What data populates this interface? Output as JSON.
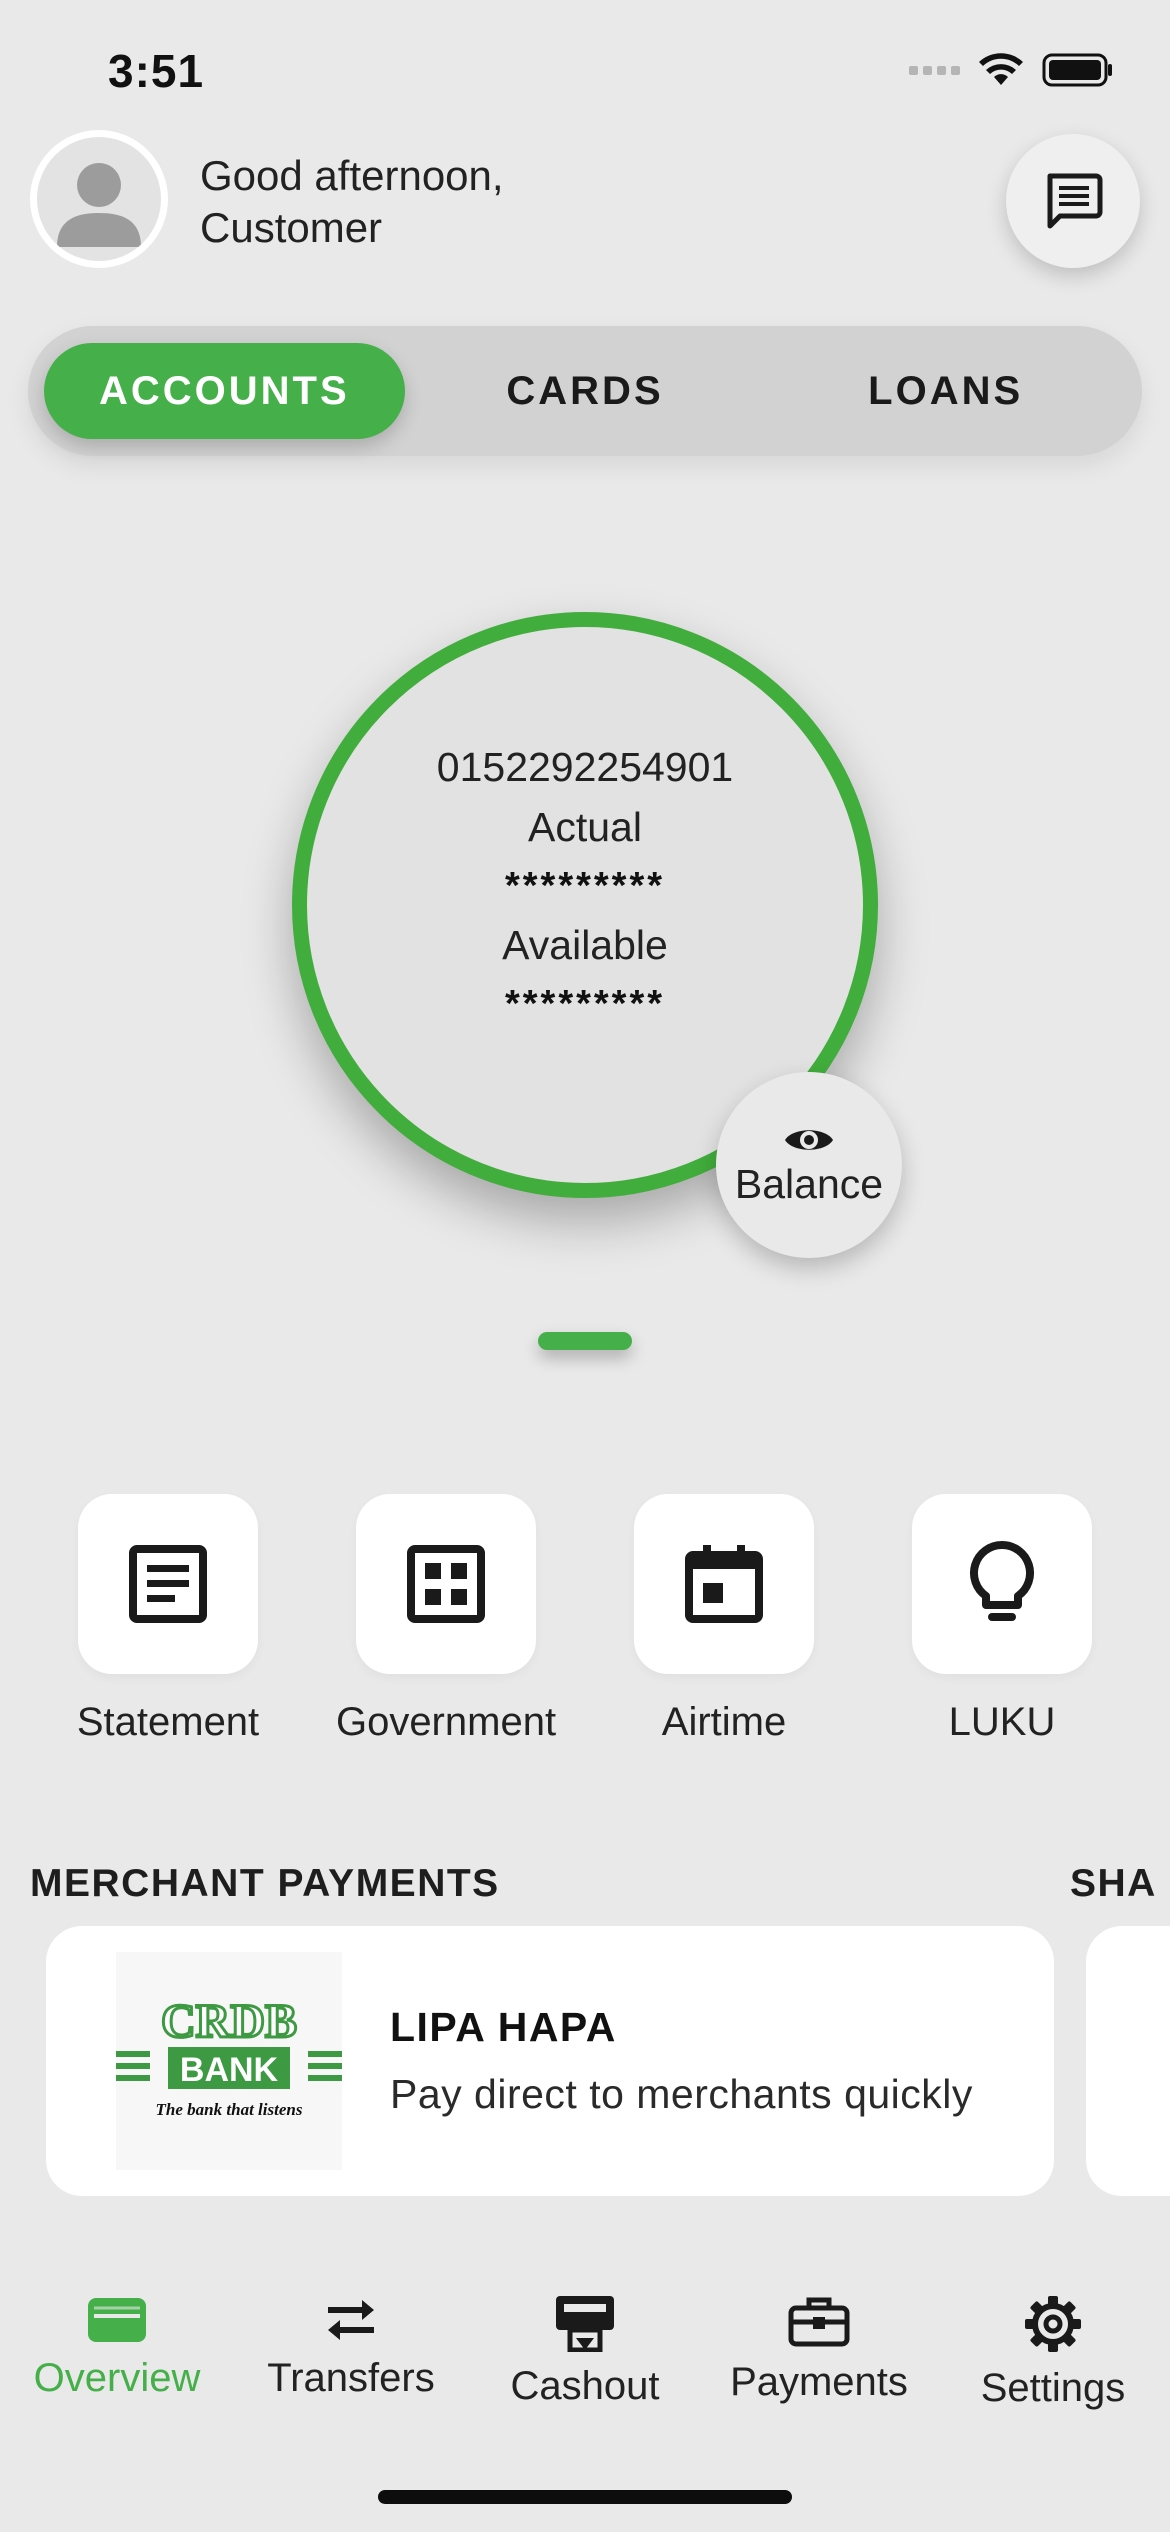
{
  "status_bar": {
    "time": "3:51",
    "icons": [
      "signal-icon",
      "wifi-icon",
      "battery-icon"
    ]
  },
  "header": {
    "greeting_line1": "Good afternoon,",
    "greeting_line2": "Customer",
    "avatar_icon": "person-icon",
    "messages_icon": "chat-icon"
  },
  "tabs": [
    {
      "label": "ACCOUNTS",
      "active": true
    },
    {
      "label": "CARDS",
      "active": false
    },
    {
      "label": "LOANS",
      "active": false
    }
  ],
  "account": {
    "number": "0152292254901",
    "actual_label": "Actual",
    "actual_value": "*********",
    "available_label": "Available",
    "available_value": "*********",
    "balance_button_label": "Balance",
    "balance_icon": "eye-icon"
  },
  "quick_actions": [
    {
      "label": "Statement",
      "icon": "document-icon"
    },
    {
      "label": "Government",
      "icon": "grid-icon"
    },
    {
      "label": "Airtime",
      "icon": "calendar-icon"
    },
    {
      "label": "LUKU",
      "icon": "lightbulb-icon"
    }
  ],
  "sections": {
    "merchant_payments": "MERCHANT PAYMENTS",
    "next_section_partial": "SHA"
  },
  "merchant_card": {
    "logo_text_top": "CRDB",
    "logo_text_bank": "BANK",
    "logo_tagline": "The bank that listens",
    "title": "LIPA HAPA",
    "subtitle": "Pay direct to merchants quickly"
  },
  "bottom_nav": [
    {
      "label": "Overview",
      "icon": "wallet-icon",
      "active": true
    },
    {
      "label": "Transfers",
      "icon": "swap-arrows-icon",
      "active": false
    },
    {
      "label": "Cashout",
      "icon": "atm-icon",
      "active": false
    },
    {
      "label": "Payments",
      "icon": "briefcase-icon",
      "active": false
    },
    {
      "label": "Settings",
      "icon": "gear-icon",
      "active": false
    }
  ],
  "colors": {
    "accent_green": "#45b04a",
    "ring_green": "#41ad3c",
    "background": "#e9e9e9"
  }
}
